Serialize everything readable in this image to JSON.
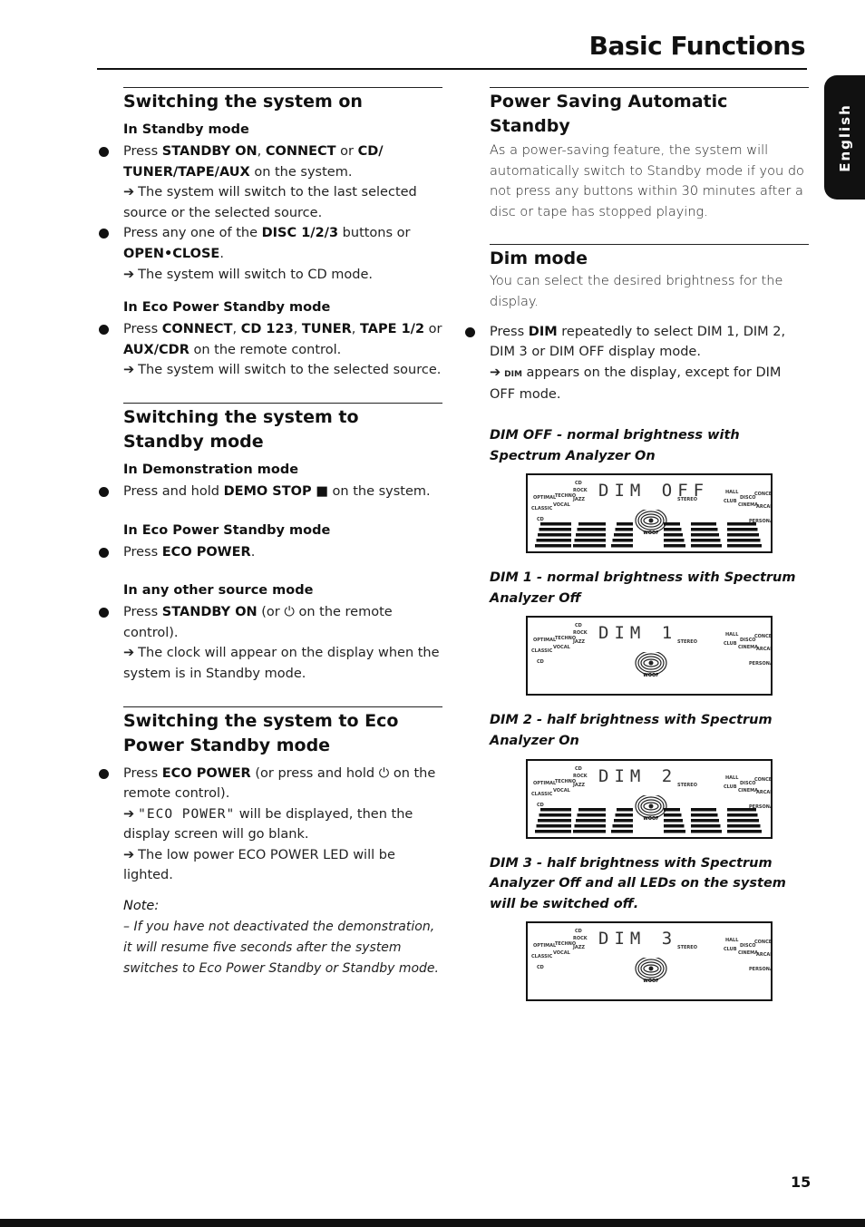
{
  "header": {
    "title": "Basic Functions",
    "language_tab": "English"
  },
  "left": {
    "switch_on": {
      "title": "Switching the system on",
      "standby_mode": {
        "subtitle": "In Standby mode",
        "items": [
          {
            "pre": "Press ",
            "b1": "STANDBY ON",
            "m1": ", ",
            "b2": "CONNECT",
            "m2": " or ",
            "b3": "CD/ TUNER/TAPE/AUX",
            "post": " on the system.",
            "result": "The system will switch to the last selected source or the selected source."
          },
          {
            "pre": "Press any one of the ",
            "b1": "DISC 1/2/3",
            "m1": " buttons or ",
            "b2": "OPEN•CLOSE",
            "post": ".",
            "result": "The system will switch to CD mode."
          }
        ]
      },
      "eco_mode": {
        "subtitle": "In Eco Power Standby mode",
        "item": {
          "pre": "Press ",
          "b1": "CONNECT",
          "m1": ", ",
          "b2": "CD 123",
          "m2": ", ",
          "b3": "TUNER",
          "m3": ", ",
          "b4": "TAPE 1/2",
          "m4": " or ",
          "b5": "AUX/CDR",
          "post": " on the remote control.",
          "result": "The system will switch to the selected source."
        }
      }
    },
    "switch_standby": {
      "title": "Switching the system to Standby mode",
      "demo": {
        "subtitle": "In Demonstration mode",
        "pre": "Press and hold ",
        "b1": "DEMO STOP",
        "icon": "■",
        "post": " on the system."
      },
      "eco": {
        "subtitle": "In Eco Power Standby mode",
        "pre": "Press ",
        "b1": "ECO POWER",
        "post": "."
      },
      "other": {
        "subtitle": "In any other source mode",
        "pre": "Press ",
        "b1": "STANDBY ON",
        "m1": " (or ",
        "icon": "⏻",
        "post": " on the remote control).",
        "result": "The clock will appear on the display when the system is in Standby mode."
      }
    },
    "switch_eco": {
      "title": "Switching the system to Eco Power Standby mode",
      "item": {
        "pre": "Press ",
        "b1": "ECO POWER",
        "m1": " (or press and hold ",
        "icon": "⏻",
        "post": " on the remote control).",
        "result1_seg": "\"ECO POWER\"",
        "result1": " will be displayed, then the display screen will go blank.",
        "result2": "The low power ECO POWER LED will be lighted."
      },
      "note_label": "Note:",
      "note": "– If you have not deactivated the demonstration, it will resume five seconds after the system switches to Eco Power Standby or Standby mode."
    }
  },
  "right": {
    "auto_standby": {
      "title": "Power Saving Automatic Standby",
      "text": "As a power-saving feature, the system will automatically switch to Standby mode if you do not press any buttons within 30 minutes after a disc or tape has stopped playing."
    },
    "dim": {
      "title": "Dim mode",
      "text": "You can select the desired brightness for the display.",
      "item": {
        "pre": "Press ",
        "b1": "DIM",
        "post": " repeatedly to select DIM 1, DIM 2, DIM 3 or DIM OFF display mode.",
        "result_small": "DIM",
        "result": " appears on the display, except for DIM OFF mode."
      },
      "modes": [
        {
          "caption": "DIM OFF - normal brightness with Spectrum Analyzer On",
          "display": "DIM OFF",
          "spectrum": true
        },
        {
          "caption": "DIM 1 - normal brightness with Spectrum Analyzer Off",
          "display": "DIM  1",
          "spectrum": false
        },
        {
          "caption": "DIM 2 - half brightness with Spectrum Analyzer On",
          "display": "DIM  2",
          "spectrum": true
        },
        {
          "caption": "DIM 3 - half brightness with Spectrum Analyzer Off and all LEDs on the system will be switched off.",
          "display": "DIM  3",
          "spectrum": false
        }
      ],
      "lcd_labels": {
        "optimal": "OPTIMAL",
        "techno": "TECHNO",
        "classic": "CLASSIC",
        "vocal": "VOCAL",
        "rock": "ROCK",
        "jazz": "JAZZ",
        "cd": "CD",
        "woof": "WOOF",
        "hall": "HALL",
        "disco": "DISCO",
        "concert": "CONCERT",
        "arcade": "ARCADE",
        "cinema": "CINEMA",
        "personal": "PERSONAL",
        "club": "CLUB",
        "stereo": "STEREO"
      }
    }
  },
  "footer": {
    "page_number": "15"
  }
}
